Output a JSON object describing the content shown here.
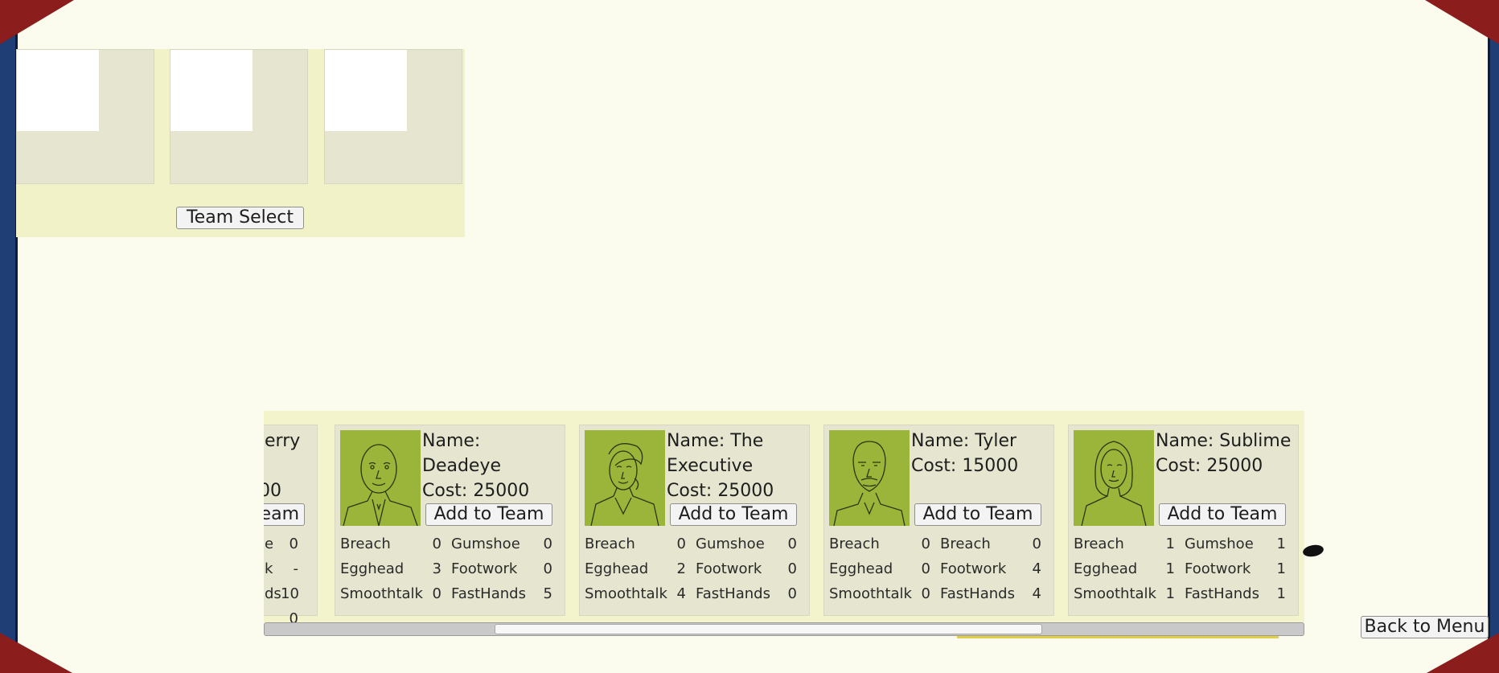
{
  "team_panel": {
    "team_select_label": "Team Select"
  },
  "roster": {
    "partial_card": {
      "name_fragment": "erry",
      "cost_fragment": "00",
      "button_fragment": "eam",
      "rows": [
        {
          "label": "e",
          "value": "0"
        },
        {
          "label": "k",
          "value": "-"
        },
        {
          "label": "ds",
          "value": "10"
        },
        {
          "label": "",
          "value": "0"
        }
      ]
    },
    "cards": [
      {
        "name_line1": "Name:",
        "name_line2": "Deadeye",
        "cost": "Cost: 25000",
        "add_label": "Add to Team",
        "stats": [
          {
            "label": "Breach",
            "value": "0"
          },
          {
            "label": "Gumshoe",
            "value": "0"
          },
          {
            "label": "Egghead",
            "value": "3"
          },
          {
            "label": "Footwork",
            "value": "0"
          },
          {
            "label": "Smoothtalk",
            "value": "0"
          },
          {
            "label": "FastHands",
            "value": "5"
          }
        ]
      },
      {
        "name_line1": "Name: The",
        "name_line2": "Executive",
        "cost": "Cost: 25000",
        "add_label": "Add to Team",
        "stats": [
          {
            "label": "Breach",
            "value": "0"
          },
          {
            "label": "Gumshoe",
            "value": "0"
          },
          {
            "label": "Egghead",
            "value": "2"
          },
          {
            "label": "Footwork",
            "value": "0"
          },
          {
            "label": "Smoothtalk",
            "value": "4"
          },
          {
            "label": "FastHands",
            "value": "0"
          }
        ]
      },
      {
        "name_line1": "Name: Tyler",
        "name_line2": "",
        "cost": "Cost: 15000",
        "add_label": "Add to Team",
        "stats": [
          {
            "label": "Breach",
            "value": "0"
          },
          {
            "label": "Breach",
            "value": "0"
          },
          {
            "label": "Egghead",
            "value": "0"
          },
          {
            "label": "Footwork",
            "value": "4"
          },
          {
            "label": "Smoothtalk",
            "value": "0"
          },
          {
            "label": "FastHands",
            "value": "4"
          }
        ]
      },
      {
        "name_line1": "Name: Sublime",
        "name_line2": "",
        "cost": "Cost: 25000",
        "add_label": "Add to Team",
        "stats": [
          {
            "label": "Breach",
            "value": "1"
          },
          {
            "label": "Gumshoe",
            "value": "1"
          },
          {
            "label": "Egghead",
            "value": "1"
          },
          {
            "label": "Footwork",
            "value": "1"
          },
          {
            "label": "Smoothtalk",
            "value": "1"
          },
          {
            "label": "FastHands",
            "value": "1"
          }
        ]
      }
    ]
  },
  "back_label": "Back to Menu",
  "colors": {
    "background": "#fbfbee",
    "frame_blue": "#1f3e76",
    "corner_red": "#8c1d1d",
    "portrait_green": "#9bb53a"
  }
}
